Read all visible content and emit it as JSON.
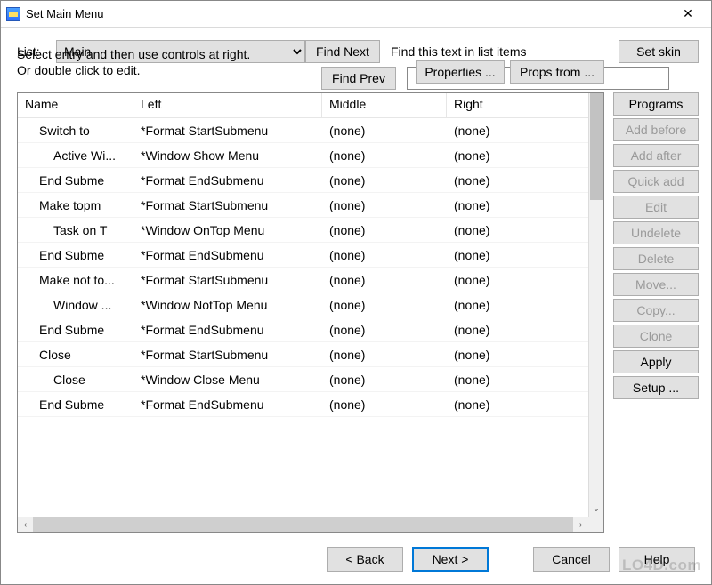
{
  "window": {
    "title": "Set Main Menu"
  },
  "top": {
    "list_label": "List:",
    "selected_list": "Main",
    "find_next": "Find Next",
    "find_prev": "Find Prev",
    "find_label": "Find this text in list items",
    "set_skin": "Set skin",
    "search_value": ""
  },
  "instructions": {
    "line1": "Select entry and then use controls at right.",
    "line2": "Or double click to edit."
  },
  "props": {
    "properties": "Properties ...",
    "props_from": "Props from ..."
  },
  "columns": {
    "name": "Name",
    "left": "Left",
    "middle": "Middle",
    "right": "Right"
  },
  "rows": [
    {
      "name": "Switch to",
      "indent": 1,
      "left": "*Format StartSubmenu",
      "middle": "(none)",
      "right": "(none)"
    },
    {
      "name": "Active Wi...",
      "indent": 2,
      "left": "*Window Show Menu",
      "middle": "(none)",
      "right": "(none)"
    },
    {
      "name": "End Subme",
      "indent": 1,
      "left": "*Format EndSubmenu",
      "middle": "(none)",
      "right": "(none)"
    },
    {
      "name": "Make topm",
      "indent": 1,
      "left": "*Format StartSubmenu",
      "middle": "(none)",
      "right": "(none)"
    },
    {
      "name": "Task on T",
      "indent": 2,
      "left": "*Window OnTop Menu",
      "middle": "(none)",
      "right": "(none)"
    },
    {
      "name": "End Subme",
      "indent": 1,
      "left": "*Format EndSubmenu",
      "middle": "(none)",
      "right": "(none)"
    },
    {
      "name": "Make not to...",
      "indent": 1,
      "left": "*Format StartSubmenu",
      "middle": "(none)",
      "right": "(none)"
    },
    {
      "name": "Window ...",
      "indent": 2,
      "left": "*Window NotTop Menu",
      "middle": "(none)",
      "right": "(none)"
    },
    {
      "name": "End Subme",
      "indent": 1,
      "left": "*Format EndSubmenu",
      "middle": "(none)",
      "right": "(none)"
    },
    {
      "name": "Close",
      "indent": 1,
      "left": "*Format StartSubmenu",
      "middle": "(none)",
      "right": "(none)"
    },
    {
      "name": "Close",
      "indent": 2,
      "left": "*Window Close Menu",
      "middle": "(none)",
      "right": "(none)"
    },
    {
      "name": "End Subme",
      "indent": 1,
      "left": "*Format EndSubmenu",
      "middle": "(none)",
      "right": "(none)"
    }
  ],
  "side": {
    "programs": "Programs",
    "add_before": "Add before",
    "add_after": "Add after",
    "quick_add": "Quick add",
    "edit": "Edit",
    "undelete": "Undelete",
    "delete": "Delete",
    "move": "Move...",
    "copy": "Copy...",
    "clone": "Clone",
    "apply": "Apply",
    "setup": "Setup ..."
  },
  "bottom": {
    "back": "Back",
    "next": "Next",
    "cancel": "Cancel",
    "help": "Help"
  },
  "watermark": "LO4D.com"
}
